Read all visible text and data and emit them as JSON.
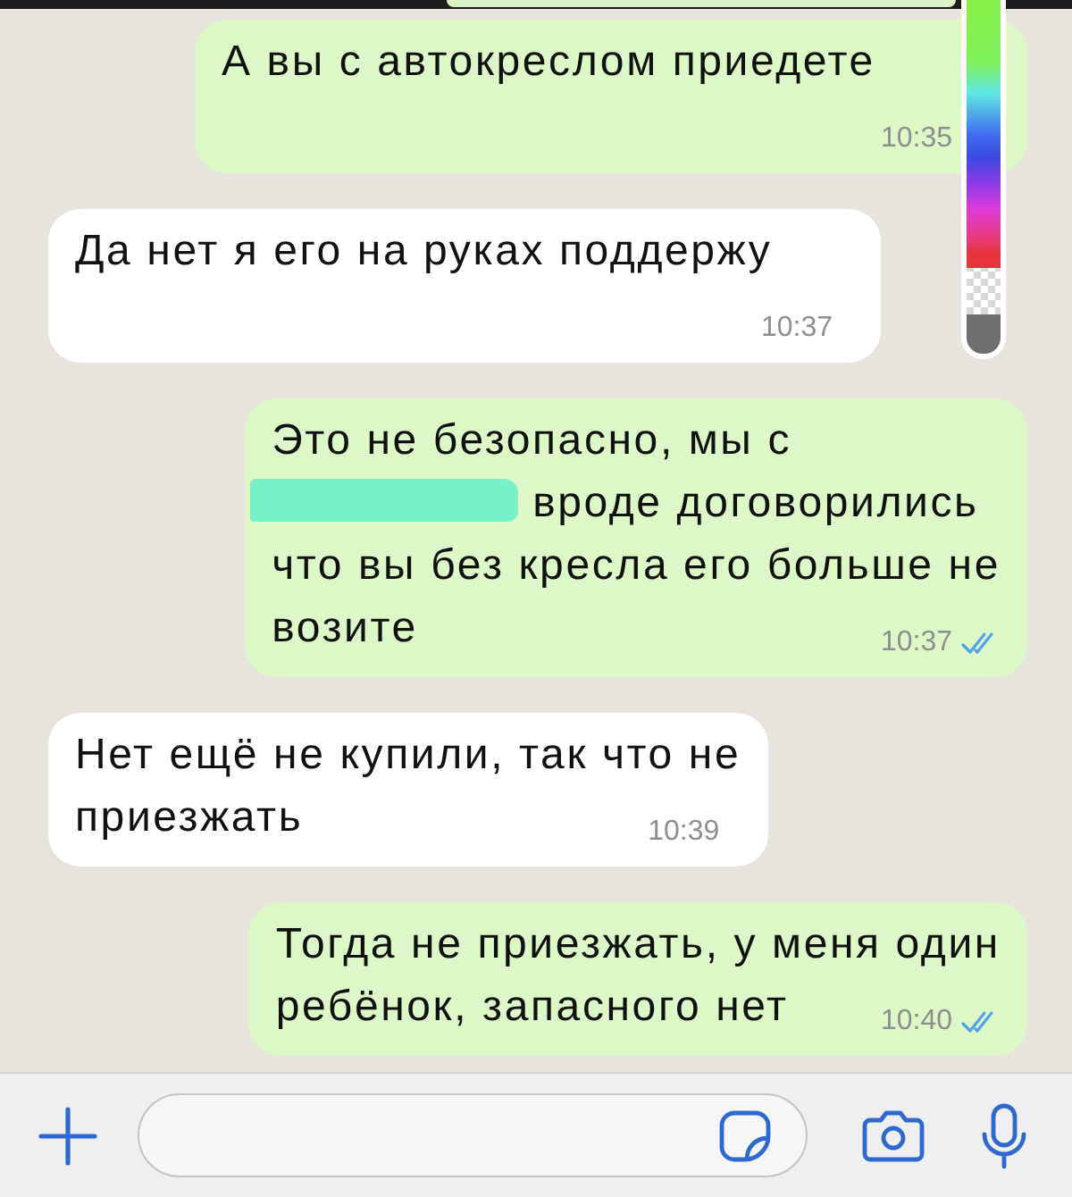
{
  "messages": [
    {
      "outgoing": true,
      "lines": [
        {
          "text": "А вы с автокреслом приедете"
        }
      ],
      "time": "10:35"
    },
    {
      "outgoing": false,
      "lines": [
        {
          "text": "Да нет я его на руках поддержу"
        }
      ],
      "time": "10:37"
    },
    {
      "outgoing": true,
      "lines": [
        {
          "text": "Это не безопасно, мы с"
        },
        {
          "redacted": true,
          "text": "вроде договорились"
        },
        {
          "text": "что вы без кресла его больше не"
        },
        {
          "text": "возите"
        }
      ],
      "time": "10:37",
      "read": true
    },
    {
      "outgoing": false,
      "lines": [
        {
          "text": "Нет ещё не купили, так что не"
        },
        {
          "text": "приезжать"
        }
      ],
      "time": "10:39"
    },
    {
      "outgoing": true,
      "lines": [
        {
          "text": "Тогда не приезжать, у меня один"
        },
        {
          "text": "ребёнок, запасного нет"
        }
      ],
      "time": "10:40",
      "read": true
    }
  ]
}
